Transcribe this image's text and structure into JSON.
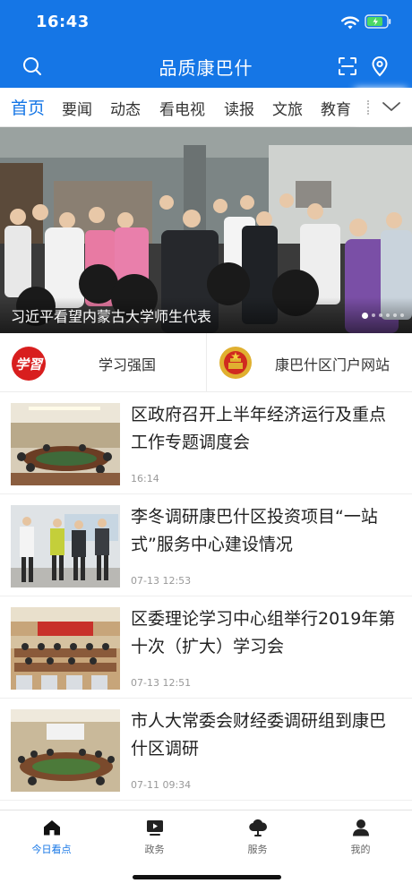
{
  "status_bar": {
    "time": "16:43"
  },
  "header": {
    "title": "品质康巴什"
  },
  "tabs": [
    {
      "label": "首页",
      "active": true
    },
    {
      "label": "要闻"
    },
    {
      "label": "动态"
    },
    {
      "label": "看电视"
    },
    {
      "label": "读报"
    },
    {
      "label": "文旅"
    },
    {
      "label": "教育"
    }
  ],
  "banner": {
    "caption": "习近平看望内蒙古大学师生代表",
    "page_count": 6,
    "current_page": 1
  },
  "shortcuts": [
    {
      "label": "学习强国",
      "logo_text": "学習"
    },
    {
      "label": "康巴什区门户网站"
    }
  ],
  "news": [
    {
      "title": "区政府召开上半年经济运行及重点工作专题调度会",
      "time": "16:14"
    },
    {
      "title": "李冬调研康巴什区投资项目“一站式”服务中心建设情况",
      "time": "07-13 12:53"
    },
    {
      "title": "区委理论学习中心组举行2019年第十次（扩大）学习会",
      "time": "07-13 12:51"
    },
    {
      "title": "市人大常委会财经委调研组到康巴什区调研",
      "time": "07-11 09:34"
    }
  ],
  "bottom_nav": [
    {
      "label": "今日看点",
      "icon": "home-icon",
      "active": true
    },
    {
      "label": "政务",
      "icon": "tv-icon"
    },
    {
      "label": "服务",
      "icon": "cloud-icon"
    },
    {
      "label": "我的",
      "icon": "user-icon"
    }
  ],
  "colors": {
    "brand_blue": "#1576e6",
    "xuexi_red": "#d81e1e"
  }
}
